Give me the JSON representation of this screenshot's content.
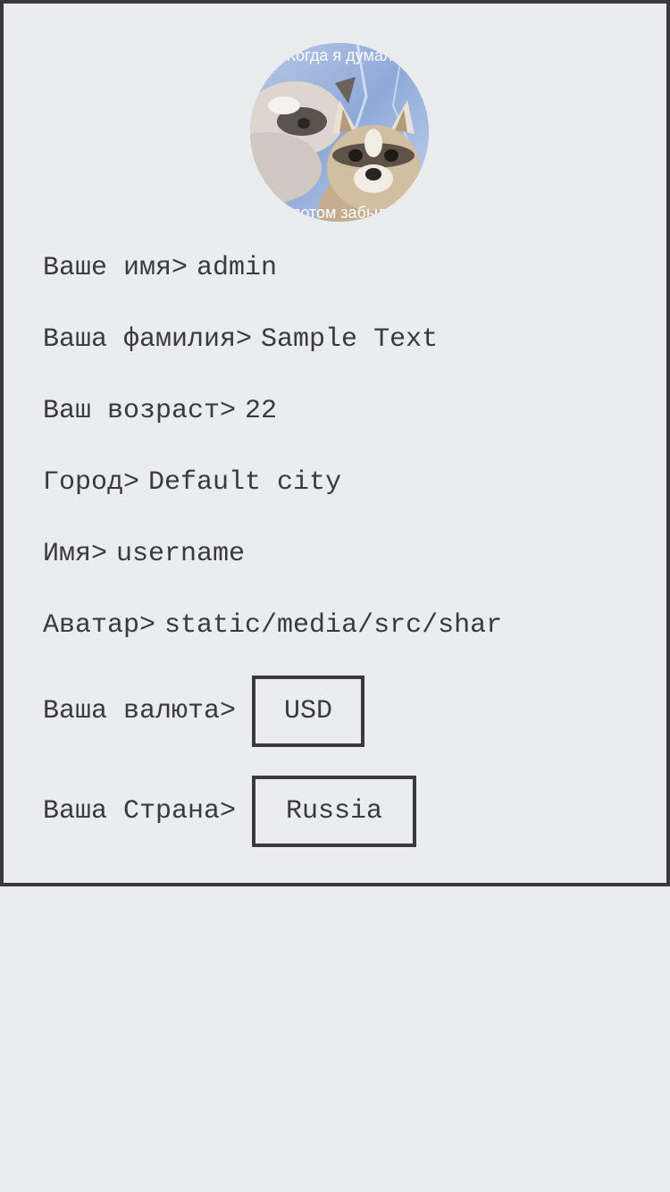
{
  "avatar": {
    "image_caption_top": "Когда я думал",
    "image_caption_bottom": "потом забыл"
  },
  "profile": {
    "first_name_label": "Ваше имя>",
    "first_name_value": "admin",
    "last_name_label": "Ваша фамилия>",
    "last_name_value": "Sample Text",
    "age_label": "Ваш возраст>",
    "age_value": "22",
    "city_label": "Город>",
    "city_value": "Default city",
    "username_label": "Имя>",
    "username_value": "username",
    "avatar_label": "Аватар>",
    "avatar_value": "static/media/src/shar",
    "currency_label": "Ваша валюта>",
    "currency_value": "USD",
    "country_label": "Ваша Страна>",
    "country_value": "Russia"
  },
  "colors": {
    "background": "#ebecee",
    "border": "#3a3a3c",
    "text": "#3a3a3c"
  }
}
